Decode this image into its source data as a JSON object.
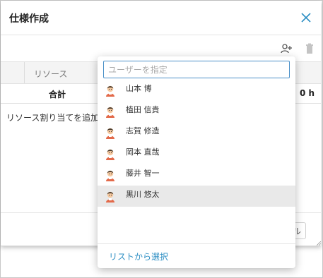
{
  "dialog": {
    "title": "仕様作成",
    "table": {
      "column_resource": "リソース",
      "total_label": "合計",
      "total_hours": "0 h"
    },
    "empty_message": "リソース割り当てを追加",
    "cancel_label": "ル"
  },
  "popup": {
    "search_placeholder": "ユーザーを指定",
    "search_value": "",
    "users": [
      {
        "name": "山本 博",
        "selected": false
      },
      {
        "name": "植田 信貴",
        "selected": false
      },
      {
        "name": "志賀 修造",
        "selected": false
      },
      {
        "name": "岡本 直哉",
        "selected": false
      },
      {
        "name": "藤井 智一",
        "selected": false
      },
      {
        "name": "黒川 悠太",
        "selected": true
      }
    ],
    "select_from_list": "リストから選択"
  },
  "colors": {
    "accent": "#2e8fc4",
    "focus_border": "#4a90c8",
    "selected_row": "#e9e9e9"
  },
  "icons": {
    "close": "close-icon",
    "add_person": "add-person-icon",
    "trash": "trash-icon",
    "avatar": "user-avatar-icon"
  }
}
